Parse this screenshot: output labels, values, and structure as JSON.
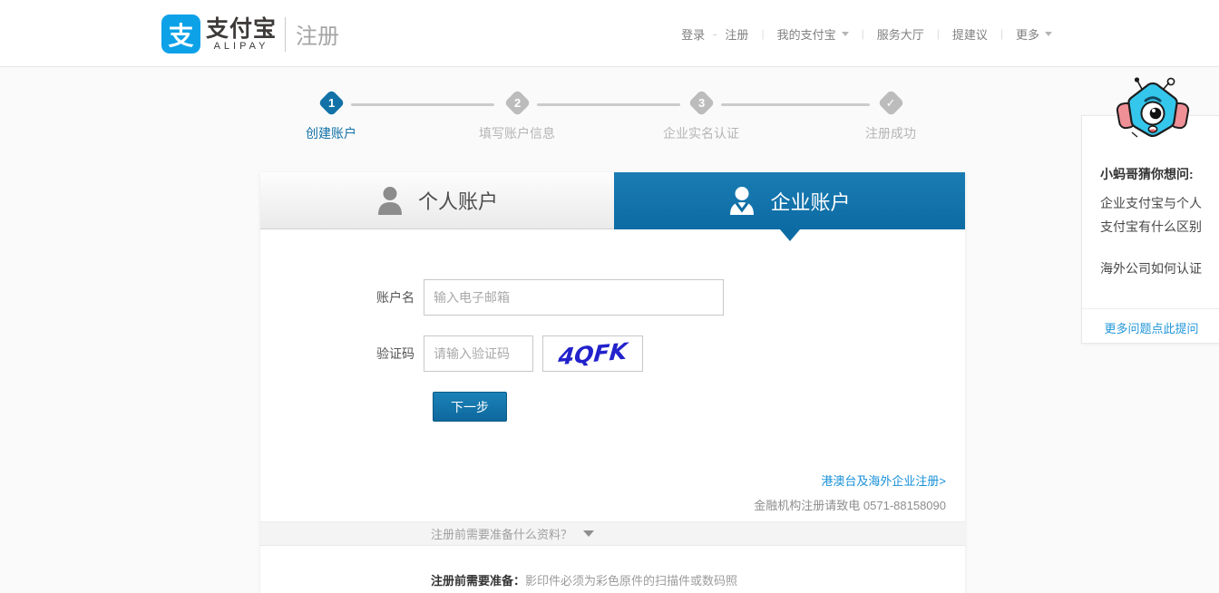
{
  "header": {
    "logo_glyph": "支",
    "brand": "支付宝",
    "brand_sub": "ALIPAY",
    "page_title": "注册",
    "nav": {
      "login": "登录",
      "register": "注册",
      "my_alipay": "我的支付宝",
      "service_hall": "服务大厅",
      "suggestion": "提建议",
      "more": "更多"
    }
  },
  "steps": {
    "items": [
      {
        "num": "1",
        "label": "创建账户"
      },
      {
        "num": "2",
        "label": "填写账户信息"
      },
      {
        "num": "3",
        "label": "企业实名认证"
      },
      {
        "num": "✓",
        "label": "注册成功"
      }
    ]
  },
  "tabs": {
    "personal": "个人账户",
    "enterprise": "企业账户"
  },
  "form": {
    "account_label": "账户名",
    "account_placeholder": "输入电子邮箱",
    "captcha_label": "验证码",
    "captcha_placeholder": "请输入验证码",
    "captcha_text": "4QFK",
    "next_button": "下一步",
    "overseas_link": "港澳台及海外企业注册>",
    "finance_note": "金融机构注册请致电 0571-88158090"
  },
  "prep": {
    "question": "注册前需要准备什么资料？",
    "note_label": "注册前需要准备：",
    "note_text": "影印件必须为彩色原件的扫描件或数码照"
  },
  "helper": {
    "title": "小蚂哥猜你想问:",
    "question_1": "企业支付宝与个人支付宝有什么区别",
    "question_2": "海外公司如何认证",
    "more_link": "更多问题点此提问"
  },
  "colors": {
    "accent_blue": "#1272a7",
    "tab_blue": "#0d6ba3",
    "link_blue": "#1790d8",
    "captcha_blue": "#2222cc",
    "logo_blue": "#0da2e8"
  }
}
